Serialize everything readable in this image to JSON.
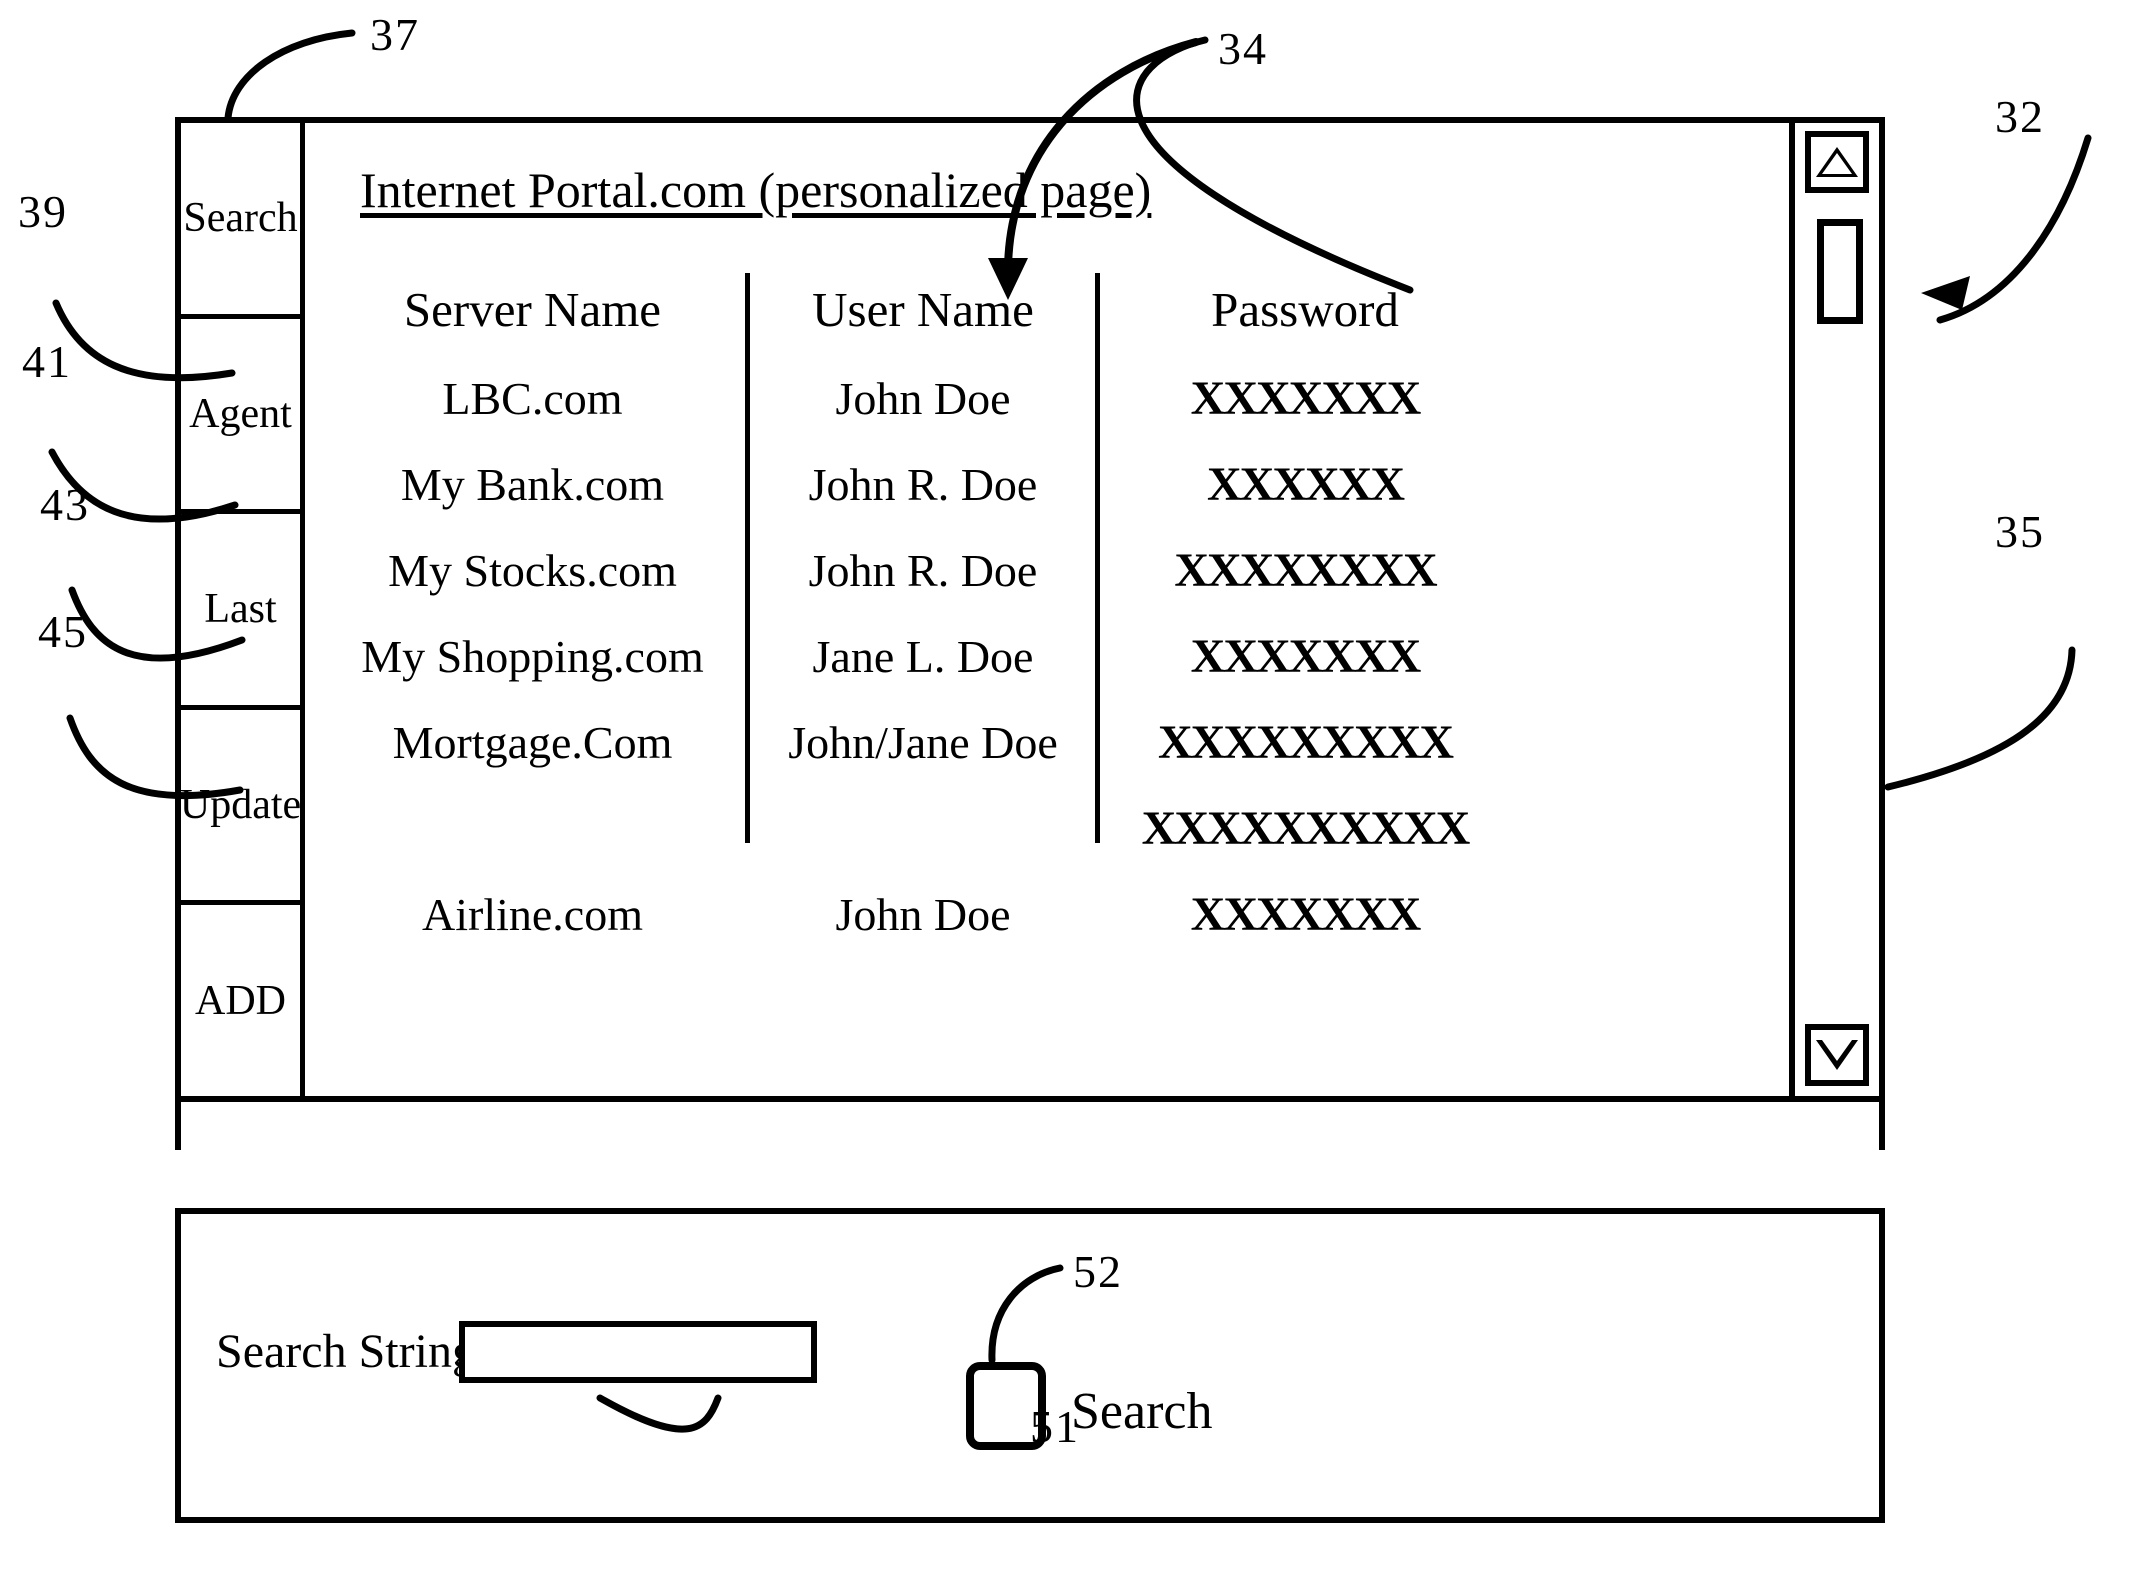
{
  "figure": {
    "reference_numerals": [
      {
        "id": "37",
        "label": "37"
      },
      {
        "id": "34",
        "label": "34"
      },
      {
        "id": "32",
        "label": "32"
      },
      {
        "id": "39",
        "label": "39"
      },
      {
        "id": "41",
        "label": "41"
      },
      {
        "id": "43",
        "label": "43"
      },
      {
        "id": "45",
        "label": "45"
      },
      {
        "id": "35",
        "label": "35"
      },
      {
        "id": "51",
        "label": "51"
      },
      {
        "id": "52",
        "label": "52"
      }
    ]
  },
  "window": {
    "sidebar": {
      "items": [
        {
          "label": "Search"
        },
        {
          "label": "Agent"
        },
        {
          "label": "Last"
        },
        {
          "label": "Update"
        },
        {
          "label": "ADD"
        }
      ]
    },
    "page": {
      "title": "Internet Portal.com (personalized page)",
      "table": {
        "headers": {
          "server": "Server Name",
          "user": "User Name",
          "password": "Password"
        },
        "rows": [
          {
            "server": "LBC.com",
            "user": "John Doe",
            "password": "XXXXXXX"
          },
          {
            "server": "My Bank.com",
            "user": "John R. Doe",
            "password": "XXXXXX"
          },
          {
            "server": "My Stocks.com",
            "user": "John R. Doe",
            "password": "XXXXXXXX"
          },
          {
            "server": "My Shopping.com",
            "user": "Jane L. Doe",
            "password": "XXXXXXX"
          },
          {
            "server": "Mortgage.Com",
            "user": "John/Jane Doe",
            "password": "XXXXXXXXX"
          },
          {
            "server": "",
            "user": "",
            "password": "XXXXXXXXXX"
          },
          {
            "server": "Airline.com",
            "user": "John Doe",
            "password": "XXXXXXX"
          }
        ]
      }
    },
    "scrollbar": {
      "up_arrow": "triangle-up",
      "down_arrow": "triangle-down"
    }
  },
  "search_panel": {
    "label": "Search String",
    "input_value": "",
    "input_placeholder": "",
    "button_label": "Search"
  }
}
